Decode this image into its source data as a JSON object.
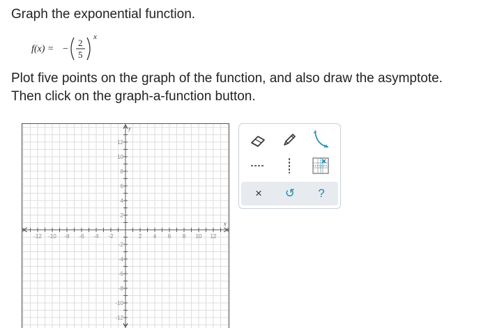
{
  "question": {
    "title": "Graph the exponential function.",
    "function": {
      "lhs": "f(x) =",
      "sign": "−",
      "numerator": "2",
      "denominator": "5",
      "exponent": "x"
    },
    "instruction_line1": "Plot five points on the graph of the function, and also draw the asymptote.",
    "instruction_line2": "Then click on the graph-a-function button."
  },
  "graph": {
    "x_axis_label": "x",
    "y_axis_label": "y",
    "x_tick_labels": [
      "-12",
      "-10",
      "-8",
      "-6",
      "-4",
      "-2",
      "2",
      "4",
      "6",
      "8",
      "10",
      "12"
    ],
    "y_tick_labels": [
      "12",
      "10",
      "8",
      "6",
      "4",
      "2",
      "-2",
      "-4",
      "-6",
      "-8",
      "-10",
      "-12"
    ],
    "x_range": [
      -14,
      14
    ],
    "y_range": [
      -14,
      14
    ],
    "grid": true,
    "colors": {
      "axis": "#555555",
      "grid": "#dddddd",
      "tick_label": "#888888"
    }
  },
  "toolbar": {
    "tools": [
      {
        "name": "eraser",
        "icon": "eraser-icon"
      },
      {
        "name": "pencil",
        "icon": "pencil-icon"
      },
      {
        "name": "curve",
        "icon": "exponential-curve-icon"
      },
      {
        "name": "horizontal-asymptote",
        "icon": "horizontal-dashed-line-icon"
      },
      {
        "name": "vertical-asymptote",
        "icon": "vertical-dashed-line-icon"
      },
      {
        "name": "graph-a-function",
        "icon": "graph-function-icon"
      }
    ],
    "actions": [
      {
        "name": "clear",
        "label": "×",
        "icon": "close-icon"
      },
      {
        "name": "undo",
        "label": "↺",
        "icon": "undo-icon"
      },
      {
        "name": "help",
        "label": "?",
        "icon": "help-icon"
      }
    ],
    "accent_color": "#1b8bb0",
    "dark_icon_color": "#333333"
  }
}
